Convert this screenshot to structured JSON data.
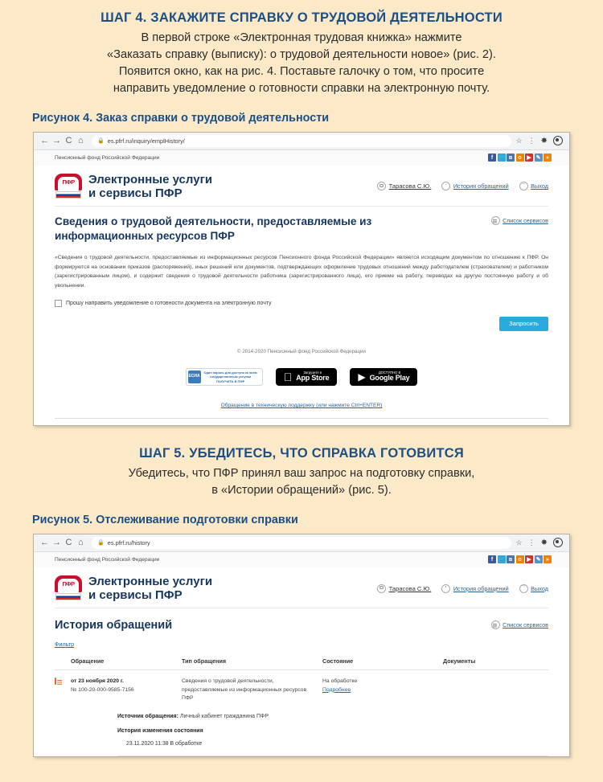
{
  "colors": {
    "page_bg": "#fbe9c8",
    "heading_blue": "#1c4f86",
    "brand_navy": "#17365d",
    "accent_button": "#29abe2",
    "link_blue": "#2a6496",
    "pfr_red": "#c8102e"
  },
  "step4": {
    "title": "ШАГ 4. ЗАКАЖИТЕ СПРАВКУ О ТРУДОВОЙ ДЕЯТЕЛЬНОСТИ",
    "lines": [
      "В первой строке «Электронная трудовая книжка» нажмите",
      "«Заказать справку (выписку): о трудовой деятельности новое» (рис. 2).",
      "Появится окно, как на рис. 4. Поставьте галочку о том, что просите",
      "направить уведомление о готовности справки на электронную почту."
    ]
  },
  "figure4": {
    "caption": "Рисунок 4. Заказ справки о трудовой деятельности",
    "browser": {
      "url": "es.pfrf.ru/inquiry/emplHistory/",
      "back_icon": "←",
      "forward_icon": "→",
      "reload_icon": "C",
      "home_icon": "⌂",
      "lock_icon": "🔒",
      "star_icon": "☆",
      "extension_icon": "✸",
      "profile_icon": "profile-avatar"
    },
    "site": {
      "topbar_text": "Пенсионный фонд Российской Федерации",
      "social": [
        {
          "name": "facebook-icon",
          "glyph": "f",
          "color": "#3b5998"
        },
        {
          "name": "twitter-icon",
          "glyph": "t",
          "color": "#2aa9e0"
        },
        {
          "name": "vk-icon",
          "glyph": "в",
          "color": "#4c75a3"
        },
        {
          "name": "odnoklassniki-icon",
          "glyph": "o",
          "color": "#ee8208"
        },
        {
          "name": "youtube-icon",
          "glyph": "▶",
          "color": "#cc332d"
        },
        {
          "name": "livejournal-icon",
          "glyph": "✎",
          "color": "#5b8fc7"
        },
        {
          "name": "rss-icon",
          "glyph": "≫",
          "color": "#ee8208"
        }
      ],
      "brand_line1": "Электронные услуги",
      "brand_line2": "и сервисы ПФР",
      "logo_text": "ПФР",
      "user_name": "Тарасова С.Ю.",
      "history_link": "История обращений",
      "logout_link": "Выход",
      "services_link": "Список сервисов"
    },
    "page_title": "Сведения о трудовой деятельности, предоставляемые из информационных ресурсов ПФР",
    "paragraph": "«Сведения о трудовой деятельности, предоставляемые из информационных ресурсов Пенсионного фонда Российской Федерации» является исходящим документом по отношению к ПФР. Он формируются на основании приказов (распоряжений), иных решений или документов, подтверждающих оформление трудовых отношений между работодателем (страхователем) и работником (зарегистрированным лицом), и содержит сведения о трудовой деятельности работника (зарегистрированного лица), его приеме на работу, переводах на другую постоянную работу и об увольнении.",
    "checkbox_label": "Прошу направить уведомление о готовности документа на электронную почту",
    "submit_button": "Запросить",
    "copyright": "© 2014-2020 Пенсионный фонд Российской Федерации",
    "badges": {
      "esia_lines": [
        "Один пароль для доступа ко всем",
        "государственным услугам",
        "ПОЛУЧИТЬ В ПФР"
      ],
      "esia_mark": "ЕСИА",
      "appstore_small": "Загрузите в",
      "appstore_big": "App Store",
      "googleplay_small": "ДОСТУПНО В",
      "googleplay_big": "Google Play"
    },
    "support_link": "Обращение в техническую поддержку (или нажмите Ctrl+ENTER)"
  },
  "step5": {
    "title": "ШАГ 5. УБЕДИТЕСЬ, ЧТО СПРАВКА ГОТОВИТСЯ",
    "lines": [
      "Убедитесь, что ПФР принял ваш запрос на подготовку справки,",
      "в «Истории обращений» (рис. 5)."
    ]
  },
  "figure5": {
    "caption": "Рисунок 5. Отслеживание подготовки справки",
    "browser": {
      "url": "es.pfrf.ru/history",
      "back_icon": "←",
      "forward_icon": "→",
      "reload_icon": "C",
      "home_icon": "⌂",
      "lock_icon": "🔒",
      "star_icon": "☆",
      "extension_icon": "✸",
      "profile_icon": "profile-avatar"
    },
    "site": {
      "topbar_text": "Пенсионный фонд Российской Федерации",
      "brand_line1": "Электронные услуги",
      "brand_line2": "и сервисы ПФР",
      "logo_text": "ПФР",
      "user_name": "Тарасова С.Ю.",
      "history_link": "История обращений",
      "logout_link": "Выход",
      "services_link": "Список сервисов"
    },
    "page_title": "История обращений",
    "filter_link": "Фильтр",
    "table": {
      "headers": [
        "Обращение",
        "Тип обращения",
        "Состояние",
        "Документы"
      ],
      "rows": [
        {
          "date": "от 23 ноября 2020 г.",
          "number": "№ 100-20-000-9585-7156",
          "type": "Сведения о трудовой деятельности, предоставляемые из информационных ресурсов ПФР",
          "state": "На обработке",
          "state_link": "Подробнее",
          "documents": ""
        }
      ]
    },
    "detail": {
      "source_label": "Источник обращения:",
      "source_value": "Личный кабинет гражданина ПФР",
      "history_head": "История изменения состояния",
      "history_items": [
        "23.11.2020 11:38 В обработке"
      ]
    }
  }
}
